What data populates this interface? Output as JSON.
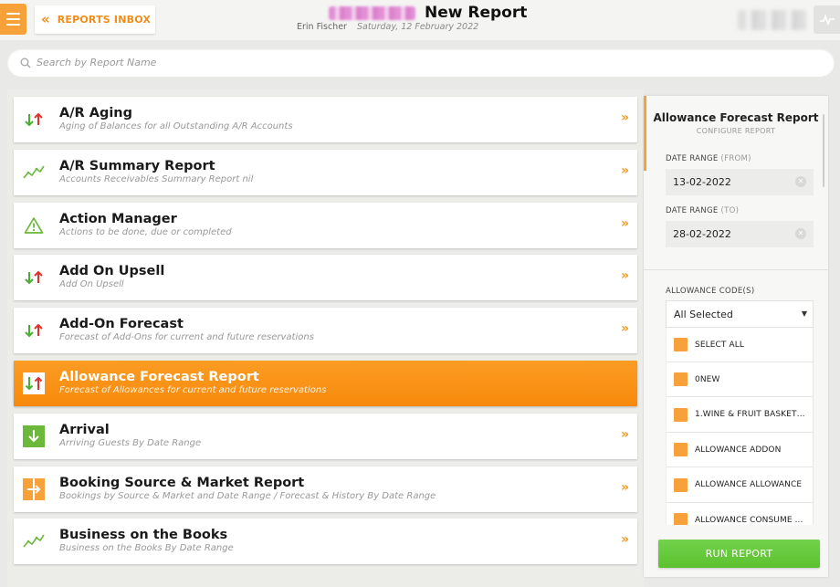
{
  "header": {
    "menu_icon": "hamburger-icon",
    "inbox_label": "REPORTS INBOX",
    "title": "New Report",
    "user": "Erin Fischer",
    "date": "Saturday, 12 February 2022",
    "activity_icon": "activity-icon"
  },
  "search": {
    "placeholder": "Search by Report Name",
    "value": ""
  },
  "reports": [
    {
      "name": "A/R Aging",
      "desc": "Aging of Balances for all Outstanding A/R Accounts",
      "icon": "up-down-arrows-icon",
      "active": false
    },
    {
      "name": "A/R Summary Report",
      "desc": "Accounts Receivables Summary Report nil",
      "icon": "trend-line-icon",
      "active": false
    },
    {
      "name": "Action Manager",
      "desc": "Actions to be done, due or completed",
      "icon": "warning-icon",
      "active": false
    },
    {
      "name": "Add On Upsell",
      "desc": "Add On Upsell",
      "icon": "up-down-arrows-icon",
      "active": false
    },
    {
      "name": "Add-On Forecast",
      "desc": "Forecast of Add-Ons for current and future reservations",
      "icon": "up-down-arrows-icon",
      "active": false
    },
    {
      "name": "Allowance Forecast Report",
      "desc": "Forecast of Allowances for current and future reservations",
      "icon": "up-down-arrows-icon",
      "active": true
    },
    {
      "name": "Arrival",
      "desc": "Arriving Guests By Date Range",
      "icon": "arrival-arrow-icon",
      "active": false
    },
    {
      "name": "Booking Source & Market Report",
      "desc": "Bookings by Source & Market and Date Range / Forecast & History By Date Range",
      "icon": "booking-source-icon",
      "active": false
    },
    {
      "name": "Business on the Books",
      "desc": "Business on the Books By Date Range",
      "icon": "trend-line-icon",
      "active": false
    }
  ],
  "config": {
    "title": "Allowance Forecast Report",
    "subtitle": "CONFIGURE REPORT",
    "date_from_label": "DATE RANGE",
    "date_from_paren": "(FROM)",
    "date_from_value": "13-02-2022",
    "date_to_label": "DATE RANGE",
    "date_to_paren": "(TO)",
    "date_to_value": "28-02-2022",
    "codes_label": "ALLOWANCE CODE(S)",
    "codes_selected": "All Selected",
    "codes_options": [
      "SELECT ALL",
      "0NEW",
      "1.WINE & FRUIT BASKETS...",
      "ALLOWANCE ADDON",
      "ALLOWANCE ALLOWANCE",
      "ALLOWANCE CONSUME ..."
    ],
    "run_label": "RUN REPORT"
  },
  "colors": {
    "accent": "#f7a13a",
    "active_row": "#f78a0c",
    "run_button": "#5cc12f"
  }
}
